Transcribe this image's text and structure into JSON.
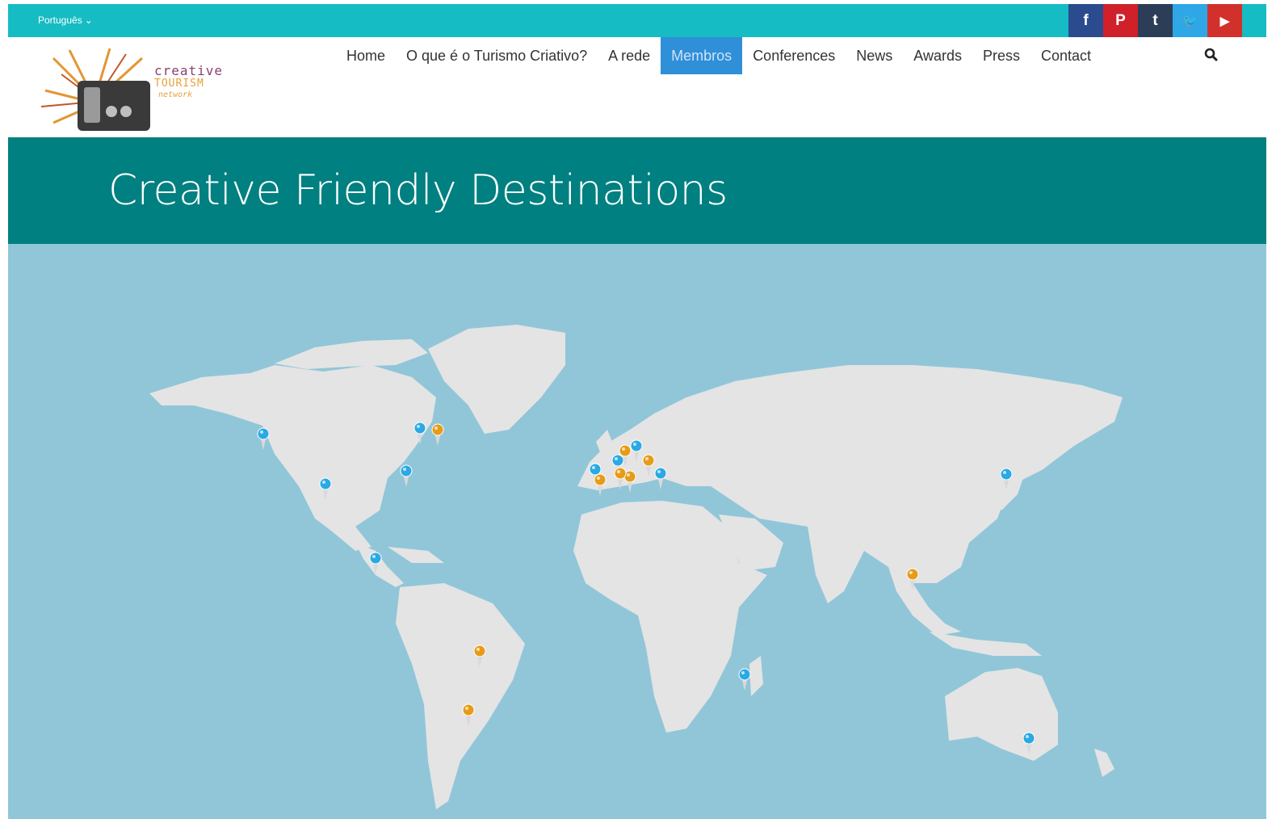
{
  "topbar": {
    "language_label": "Português",
    "socials": [
      {
        "icon": "facebook-icon",
        "glyph": "f",
        "color": "#2a4b8d"
      },
      {
        "icon": "pinterest-icon",
        "glyph": "P",
        "color": "#d0202a"
      },
      {
        "icon": "tumblr-icon",
        "glyph": "t",
        "color": "#2c3e57"
      },
      {
        "icon": "twitter-icon",
        "glyph": "🐦",
        "color": "#2fa6e6"
      },
      {
        "icon": "youtube-icon",
        "glyph": "▶",
        "color": "#d2312b"
      }
    ]
  },
  "logo": {
    "text_line1": "creative",
    "text_line2": "TOURISM",
    "text_line3": "network"
  },
  "nav": {
    "items": [
      "Home",
      "O que é o Turismo Criativo?",
      "A rede",
      "Membros",
      "Conferences",
      "News",
      "Awards",
      "Press",
      "Contact"
    ],
    "active": "Membros"
  },
  "page": {
    "title": "Creative Friendly Destinations"
  },
  "map": {
    "ocean_color": "#91c6d9",
    "land_color": "#e4e4e4",
    "pin_colors": {
      "blue": "#2aa9e4",
      "orange": "#e79b17"
    }
  }
}
